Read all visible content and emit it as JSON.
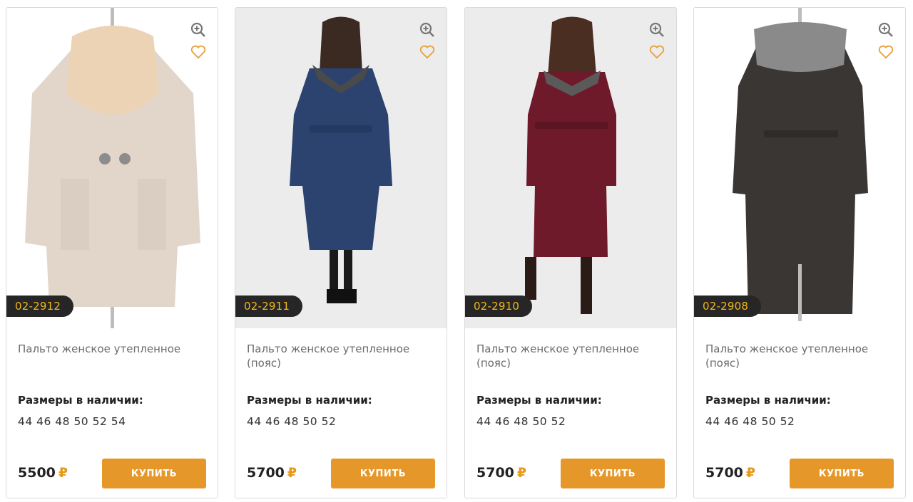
{
  "currency_symbol": "₽",
  "accent_color": "#e6972a",
  "sku_badge_bg": "#262626",
  "sku_badge_text": "#f2b51e",
  "icons": {
    "zoom": "zoom-in-icon",
    "favorite": "heart-icon"
  },
  "products": [
    {
      "sku": "02-2912",
      "name": "Пальто женское утепленное",
      "sizes_label": "Размеры в наличии:",
      "sizes": "44 46 48 50 52 54",
      "price": "5500",
      "buy_label": "КУПИТЬ",
      "coat_color": "#e2d6cb",
      "collar_color": "#ecd3b6"
    },
    {
      "sku": "02-2911",
      "name": "Пальто женское утепленное (пояс)",
      "sizes_label": "Размеры в наличии:",
      "sizes": "44 46 48 50 52",
      "price": "5700",
      "buy_label": "КУПИТЬ",
      "coat_color": "#2c4370",
      "collar_color": "#4a4a4a"
    },
    {
      "sku": "02-2910",
      "name": "Пальто женское утепленное (пояс)",
      "sizes_label": "Размеры в наличии:",
      "sizes": "44 46 48 50 52",
      "price": "5700",
      "buy_label": "КУПИТЬ",
      "coat_color": "#6e1a2a",
      "collar_color": "#5a5a5a"
    },
    {
      "sku": "02-2908",
      "name": "Пальто женское утепленное (пояс)",
      "sizes_label": "Размеры в наличии:",
      "sizes": "44 46 48 50 52",
      "price": "5700",
      "buy_label": "КУПИТЬ",
      "coat_color": "#3a3634",
      "collar_color": "#8a8a8a"
    }
  ]
}
